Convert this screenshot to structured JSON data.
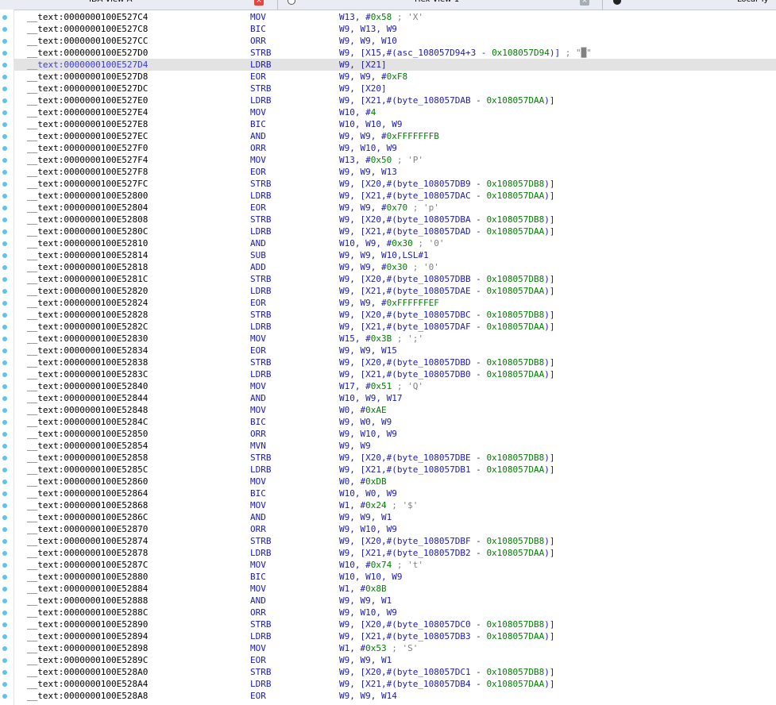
{
  "tabs": [
    {
      "label": "IDA View-A"
    },
    {
      "label": "Hex View-1"
    },
    {
      "label": "Local Ty"
    }
  ],
  "selected_index": 4,
  "rows": [
    {
      "addr": "__text:0000000100E527C4",
      "mn": "MOV",
      "ops": [
        {
          "t": "W13, #"
        },
        {
          "t": "0x58",
          "c": "num"
        },
        {
          "t": " ; 'X'",
          "c": "cmt"
        }
      ]
    },
    {
      "addr": "__text:0000000100E527C8",
      "mn": "BIC",
      "ops": [
        {
          "t": "W9, W13, W9"
        }
      ]
    },
    {
      "addr": "__text:0000000100E527CC",
      "mn": "ORR",
      "ops": [
        {
          "t": "W9, W9, W10"
        }
      ]
    },
    {
      "addr": "__text:0000000100E527D0",
      "mn": "STRB",
      "ops": [
        {
          "t": "W9, [X15,#(asc_108057D94+3 - "
        },
        {
          "t": "0x108057D94",
          "c": "num"
        },
        {
          "t": ")]"
        },
        {
          "t": " ; \"█\"",
          "c": "cmt"
        }
      ]
    },
    {
      "addr": "__text:0000000100E527D4",
      "mn": "LDRB",
      "ops": [
        {
          "t": "W9, [X21]"
        }
      ]
    },
    {
      "addr": "__text:0000000100E527D8",
      "mn": "EOR",
      "ops": [
        {
          "t": "W9, W9, #"
        },
        {
          "t": "0xF8",
          "c": "num"
        }
      ]
    },
    {
      "addr": "__text:0000000100E527DC",
      "mn": "STRB",
      "ops": [
        {
          "t": "W9, [X20]"
        }
      ]
    },
    {
      "addr": "__text:0000000100E527E0",
      "mn": "LDRB",
      "ops": [
        {
          "t": "W9, [X21,#(byte_108057DAB - "
        },
        {
          "t": "0x108057DAA",
          "c": "num"
        },
        {
          "t": ")]"
        }
      ]
    },
    {
      "addr": "__text:0000000100E527E4",
      "mn": "MOV",
      "ops": [
        {
          "t": "W10, #"
        },
        {
          "t": "4",
          "c": "num"
        }
      ]
    },
    {
      "addr": "__text:0000000100E527E8",
      "mn": "BIC",
      "ops": [
        {
          "t": "W10, W10, W9"
        }
      ]
    },
    {
      "addr": "__text:0000000100E527EC",
      "mn": "AND",
      "ops": [
        {
          "t": "W9, W9, #"
        },
        {
          "t": "0xFFFFFFFB",
          "c": "num"
        }
      ]
    },
    {
      "addr": "__text:0000000100E527F0",
      "mn": "ORR",
      "ops": [
        {
          "t": "W9, W10, W9"
        }
      ]
    },
    {
      "addr": "__text:0000000100E527F4",
      "mn": "MOV",
      "ops": [
        {
          "t": "W13, #"
        },
        {
          "t": "0x50",
          "c": "num"
        },
        {
          "t": " ; 'P'",
          "c": "cmt"
        }
      ]
    },
    {
      "addr": "__text:0000000100E527F8",
      "mn": "EOR",
      "ops": [
        {
          "t": "W9, W9, W13"
        }
      ]
    },
    {
      "addr": "__text:0000000100E527FC",
      "mn": "STRB",
      "ops": [
        {
          "t": "W9, [X20,#(byte_108057DB9 - "
        },
        {
          "t": "0x108057DB8",
          "c": "num"
        },
        {
          "t": ")]"
        }
      ]
    },
    {
      "addr": "__text:0000000100E52800",
      "mn": "LDRB",
      "ops": [
        {
          "t": "W9, [X21,#(byte_108057DAC - "
        },
        {
          "t": "0x108057DAA",
          "c": "num"
        },
        {
          "t": ")]"
        }
      ]
    },
    {
      "addr": "__text:0000000100E52804",
      "mn": "EOR",
      "ops": [
        {
          "t": "W9, W9, #"
        },
        {
          "t": "0x70",
          "c": "num"
        },
        {
          "t": " ; 'p'",
          "c": "cmt"
        }
      ]
    },
    {
      "addr": "__text:0000000100E52808",
      "mn": "STRB",
      "ops": [
        {
          "t": "W9, [X20,#(byte_108057DBA - "
        },
        {
          "t": "0x108057DB8",
          "c": "num"
        },
        {
          "t": ")]"
        }
      ]
    },
    {
      "addr": "__text:0000000100E5280C",
      "mn": "LDRB",
      "ops": [
        {
          "t": "W9, [X21,#(byte_108057DAD - "
        },
        {
          "t": "0x108057DAA",
          "c": "num"
        },
        {
          "t": ")]"
        }
      ]
    },
    {
      "addr": "__text:0000000100E52810",
      "mn": "AND",
      "ops": [
        {
          "t": "W10, W9, #"
        },
        {
          "t": "0x30",
          "c": "num"
        },
        {
          "t": " ; '0'",
          "c": "cmt"
        }
      ]
    },
    {
      "addr": "__text:0000000100E52814",
      "mn": "SUB",
      "ops": [
        {
          "t": "W9, W9, W10,LSL#1"
        }
      ]
    },
    {
      "addr": "__text:0000000100E52818",
      "mn": "ADD",
      "ops": [
        {
          "t": "W9, W9, #"
        },
        {
          "t": "0x30",
          "c": "num"
        },
        {
          "t": " ; '0'",
          "c": "cmt"
        }
      ]
    },
    {
      "addr": "__text:0000000100E5281C",
      "mn": "STRB",
      "ops": [
        {
          "t": "W9, [X20,#(byte_108057DBB - "
        },
        {
          "t": "0x108057DB8",
          "c": "num"
        },
        {
          "t": ")]"
        }
      ]
    },
    {
      "addr": "__text:0000000100E52820",
      "mn": "LDRB",
      "ops": [
        {
          "t": "W9, [X21,#(byte_108057DAE - "
        },
        {
          "t": "0x108057DAA",
          "c": "num"
        },
        {
          "t": ")]"
        }
      ]
    },
    {
      "addr": "__text:0000000100E52824",
      "mn": "EOR",
      "ops": [
        {
          "t": "W9, W9, #"
        },
        {
          "t": "0xFFFFFFEF",
          "c": "num"
        }
      ]
    },
    {
      "addr": "__text:0000000100E52828",
      "mn": "STRB",
      "ops": [
        {
          "t": "W9, [X20,#(byte_108057DBC - "
        },
        {
          "t": "0x108057DB8",
          "c": "num"
        },
        {
          "t": ")]"
        }
      ]
    },
    {
      "addr": "__text:0000000100E5282C",
      "mn": "LDRB",
      "ops": [
        {
          "t": "W9, [X21,#(byte_108057DAF - "
        },
        {
          "t": "0x108057DAA",
          "c": "num"
        },
        {
          "t": ")]"
        }
      ]
    },
    {
      "addr": "__text:0000000100E52830",
      "mn": "MOV",
      "ops": [
        {
          "t": "W15, #"
        },
        {
          "t": "0x3B",
          "c": "num"
        },
        {
          "t": " ; ';'",
          "c": "cmt"
        }
      ]
    },
    {
      "addr": "__text:0000000100E52834",
      "mn": "EOR",
      "ops": [
        {
          "t": "W9, W9, W15"
        }
      ]
    },
    {
      "addr": "__text:0000000100E52838",
      "mn": "STRB",
      "ops": [
        {
          "t": "W9, [X20,#(byte_108057DBD - "
        },
        {
          "t": "0x108057DB8",
          "c": "num"
        },
        {
          "t": ")]"
        }
      ]
    },
    {
      "addr": "__text:0000000100E5283C",
      "mn": "LDRB",
      "ops": [
        {
          "t": "W9, [X21,#(byte_108057DB0 - "
        },
        {
          "t": "0x108057DAA",
          "c": "num"
        },
        {
          "t": ")]"
        }
      ]
    },
    {
      "addr": "__text:0000000100E52840",
      "mn": "MOV",
      "ops": [
        {
          "t": "W17, #"
        },
        {
          "t": "0x51",
          "c": "num"
        },
        {
          "t": " ; 'Q'",
          "c": "cmt"
        }
      ]
    },
    {
      "addr": "__text:0000000100E52844",
      "mn": "AND",
      "ops": [
        {
          "t": "W10, W9, W17"
        }
      ]
    },
    {
      "addr": "__text:0000000100E52848",
      "mn": "MOV",
      "ops": [
        {
          "t": "W0, #"
        },
        {
          "t": "0xAE",
          "c": "num"
        }
      ]
    },
    {
      "addr": "__text:0000000100E5284C",
      "mn": "BIC",
      "ops": [
        {
          "t": "W9, W0, W9"
        }
      ]
    },
    {
      "addr": "__text:0000000100E52850",
      "mn": "ORR",
      "ops": [
        {
          "t": "W9, W10, W9"
        }
      ]
    },
    {
      "addr": "__text:0000000100E52854",
      "mn": "MVN",
      "ops": [
        {
          "t": "W9, W9"
        }
      ]
    },
    {
      "addr": "__text:0000000100E52858",
      "mn": "STRB",
      "ops": [
        {
          "t": "W9, [X20,#(byte_108057DBE - "
        },
        {
          "t": "0x108057DB8",
          "c": "num"
        },
        {
          "t": ")]"
        }
      ]
    },
    {
      "addr": "__text:0000000100E5285C",
      "mn": "LDRB",
      "ops": [
        {
          "t": "W9, [X21,#(byte_108057DB1 - "
        },
        {
          "t": "0x108057DAA",
          "c": "num"
        },
        {
          "t": ")]"
        }
      ]
    },
    {
      "addr": "__text:0000000100E52860",
      "mn": "MOV",
      "ops": [
        {
          "t": "W0, #"
        },
        {
          "t": "0xDB",
          "c": "num"
        }
      ]
    },
    {
      "addr": "__text:0000000100E52864",
      "mn": "BIC",
      "ops": [
        {
          "t": "W10, W0, W9"
        }
      ]
    },
    {
      "addr": "__text:0000000100E52868",
      "mn": "MOV",
      "ops": [
        {
          "t": "W1, #"
        },
        {
          "t": "0x24",
          "c": "num"
        },
        {
          "t": " ; '$'",
          "c": "cmt"
        }
      ]
    },
    {
      "addr": "__text:0000000100E5286C",
      "mn": "AND",
      "ops": [
        {
          "t": "W9, W9, W1"
        }
      ]
    },
    {
      "addr": "__text:0000000100E52870",
      "mn": "ORR",
      "ops": [
        {
          "t": "W9, W10, W9"
        }
      ]
    },
    {
      "addr": "__text:0000000100E52874",
      "mn": "STRB",
      "ops": [
        {
          "t": "W9, [X20,#(byte_108057DBF - "
        },
        {
          "t": "0x108057DB8",
          "c": "num"
        },
        {
          "t": ")]"
        }
      ]
    },
    {
      "addr": "__text:0000000100E52878",
      "mn": "LDRB",
      "ops": [
        {
          "t": "W9, [X21,#(byte_108057DB2 - "
        },
        {
          "t": "0x108057DAA",
          "c": "num"
        },
        {
          "t": ")]"
        }
      ]
    },
    {
      "addr": "__text:0000000100E5287C",
      "mn": "MOV",
      "ops": [
        {
          "t": "W10, #"
        },
        {
          "t": "0x74",
          "c": "num"
        },
        {
          "t": " ; 't'",
          "c": "cmt"
        }
      ]
    },
    {
      "addr": "__text:0000000100E52880",
      "mn": "BIC",
      "ops": [
        {
          "t": "W10, W10, W9"
        }
      ]
    },
    {
      "addr": "__text:0000000100E52884",
      "mn": "MOV",
      "ops": [
        {
          "t": "W1, #"
        },
        {
          "t": "0x8B",
          "c": "num"
        }
      ]
    },
    {
      "addr": "__text:0000000100E52888",
      "mn": "AND",
      "ops": [
        {
          "t": "W9, W9, W1"
        }
      ]
    },
    {
      "addr": "__text:0000000100E5288C",
      "mn": "ORR",
      "ops": [
        {
          "t": "W9, W10, W9"
        }
      ]
    },
    {
      "addr": "__text:0000000100E52890",
      "mn": "STRB",
      "ops": [
        {
          "t": "W9, [X20,#(byte_108057DC0 - "
        },
        {
          "t": "0x108057DB8",
          "c": "num"
        },
        {
          "t": ")]"
        }
      ]
    },
    {
      "addr": "__text:0000000100E52894",
      "mn": "LDRB",
      "ops": [
        {
          "t": "W9, [X21,#(byte_108057DB3 - "
        },
        {
          "t": "0x108057DAA",
          "c": "num"
        },
        {
          "t": ")]"
        }
      ]
    },
    {
      "addr": "__text:0000000100E52898",
      "mn": "MOV",
      "ops": [
        {
          "t": "W1, #"
        },
        {
          "t": "0x53",
          "c": "num"
        },
        {
          "t": " ; 'S'",
          "c": "cmt"
        }
      ]
    },
    {
      "addr": "__text:0000000100E5289C",
      "mn": "EOR",
      "ops": [
        {
          "t": "W9, W9, W1"
        }
      ]
    },
    {
      "addr": "__text:0000000100E528A0",
      "mn": "STRB",
      "ops": [
        {
          "t": "W9, [X20,#(byte_108057DC1 - "
        },
        {
          "t": "0x108057DB8",
          "c": "num"
        },
        {
          "t": ")]"
        }
      ]
    },
    {
      "addr": "__text:0000000100E528A4",
      "mn": "LDRB",
      "ops": [
        {
          "t": "W9, [X21,#(byte_108057DB4 - "
        },
        {
          "t": "0x108057DAA",
          "c": "num"
        },
        {
          "t": ")]"
        }
      ]
    },
    {
      "addr": "__text:0000000100E528A8",
      "mn": "EOR",
      "ops": [
        {
          "t": "W9, W9, W14"
        }
      ]
    }
  ]
}
